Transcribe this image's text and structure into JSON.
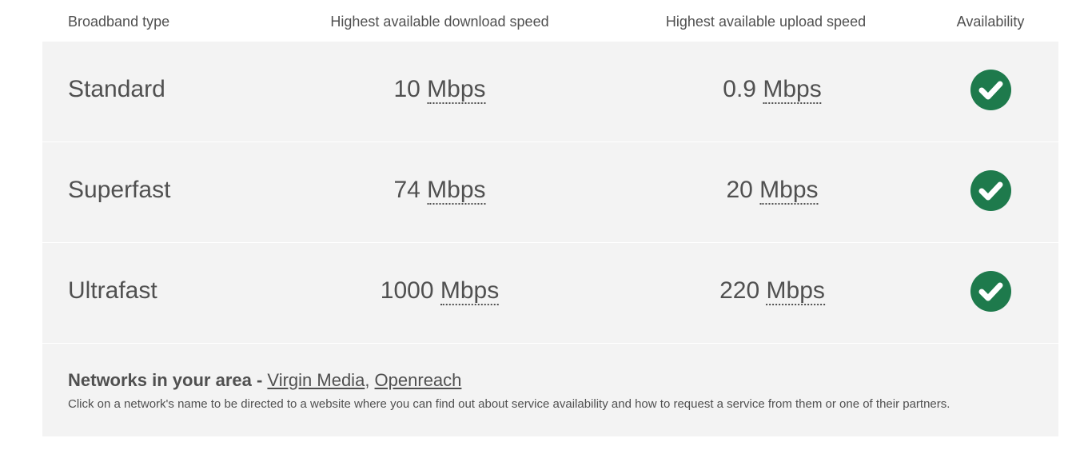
{
  "table": {
    "headers": {
      "type": "Broadband type",
      "download": "Highest available download speed",
      "upload": "Highest available upload speed",
      "availability": "Availability"
    },
    "rows": [
      {
        "type": "Standard",
        "download_value": "10",
        "download_unit": "Mbps",
        "upload_value": "0.9",
        "upload_unit": "Mbps",
        "available": true,
        "icon": "check-circle-icon"
      },
      {
        "type": "Superfast",
        "download_value": "74",
        "download_unit": "Mbps",
        "upload_value": "20",
        "upload_unit": "Mbps",
        "available": true,
        "icon": "check-circle-icon"
      },
      {
        "type": "Ultrafast",
        "download_value": "1000",
        "download_unit": "Mbps",
        "upload_value": "220",
        "upload_unit": "Mbps",
        "available": true,
        "icon": "check-circle-icon"
      }
    ]
  },
  "networks": {
    "title": "Networks in your area - ",
    "links": [
      "Virgin Media",
      "Openreach"
    ],
    "separator": ", ",
    "note": "Click on a network's name to be directed to a website where you can find out about service availability and how to request a service from them or one of their partners."
  },
  "colors": {
    "available_green": "#1e7a4c",
    "row_background": "#f3f3f3",
    "text": "#505050"
  }
}
